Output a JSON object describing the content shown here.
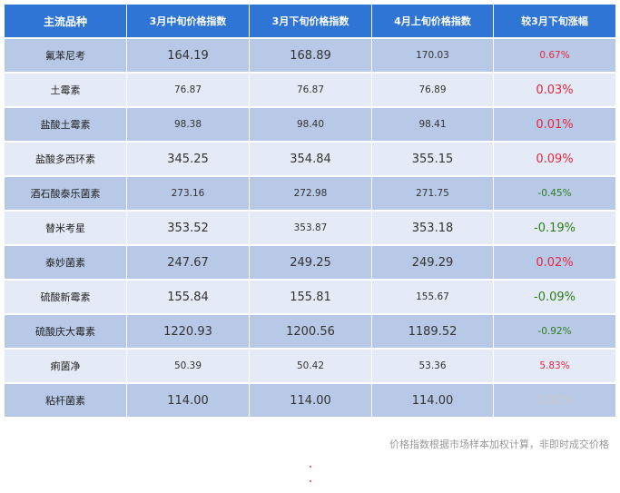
{
  "headers": [
    "主流品种",
    "3月中旬价格指数",
    "3月下旬价格指数",
    "4月上旬价格指数",
    "较3月下旬涨幅"
  ],
  "rows": [
    {
      "name": "氟苯尼考",
      "mid_mar": "164.19",
      "late_mar": "168.89",
      "early_apr": "170.03",
      "change": "0.67%",
      "dir": "pos"
    },
    {
      "name": "土霉素",
      "mid_mar": "76.87",
      "late_mar": "76.87",
      "early_apr": "76.89",
      "change": "0.03%",
      "dir": "pos"
    },
    {
      "name": "盐酸土霉素",
      "mid_mar": "98.38",
      "late_mar": "98.40",
      "early_apr": "98.41",
      "change": "0.01%",
      "dir": "pos"
    },
    {
      "name": "盐酸多西环素",
      "mid_mar": "345.25",
      "late_mar": "354.84",
      "early_apr": "355.15",
      "change": "0.09%",
      "dir": "pos"
    },
    {
      "name": "酒石酸泰乐菌素",
      "mid_mar": "273.16",
      "late_mar": "272.98",
      "early_apr": "271.75",
      "change": "-0.45%",
      "dir": "neg"
    },
    {
      "name": "替米考星",
      "mid_mar": "353.52",
      "late_mar": "353.87",
      "early_apr": "353.18",
      "change": "-0.19%",
      "dir": "neg"
    },
    {
      "name": "泰妙菌素",
      "mid_mar": "247.67",
      "late_mar": "249.25",
      "early_apr": "249.29",
      "change": "0.02%",
      "dir": "pos"
    },
    {
      "name": "硫酸新霉素",
      "mid_mar": "155.84",
      "late_mar": "155.81",
      "early_apr": "155.67",
      "change": "-0.09%",
      "dir": "neg"
    },
    {
      "name": "硫酸庆大霉素",
      "mid_mar": "1220.93",
      "late_mar": "1200.56",
      "early_apr": "1189.52",
      "change": "-0.92%",
      "dir": "neg"
    },
    {
      "name": "痢菌净",
      "mid_mar": "50.39",
      "late_mar": "50.42",
      "early_apr": "53.36",
      "change": "5.83%",
      "dir": "pos"
    },
    {
      "name": "粘杆菌素",
      "mid_mar": "114.00",
      "late_mar": "114.00",
      "early_apr": "114.00",
      "change": "0.00%",
      "dir": "zero"
    }
  ],
  "note": "价格指数根据市场样本加权计算，非即时成交价格",
  "colors": {
    "header_bg": "#2f75d6",
    "row_dark": "#b7c9e6",
    "row_light": "#e4ebf6",
    "positive": "#e8273f",
    "negative": "#2e7d1a",
    "zero": "#c9c9c9"
  }
}
